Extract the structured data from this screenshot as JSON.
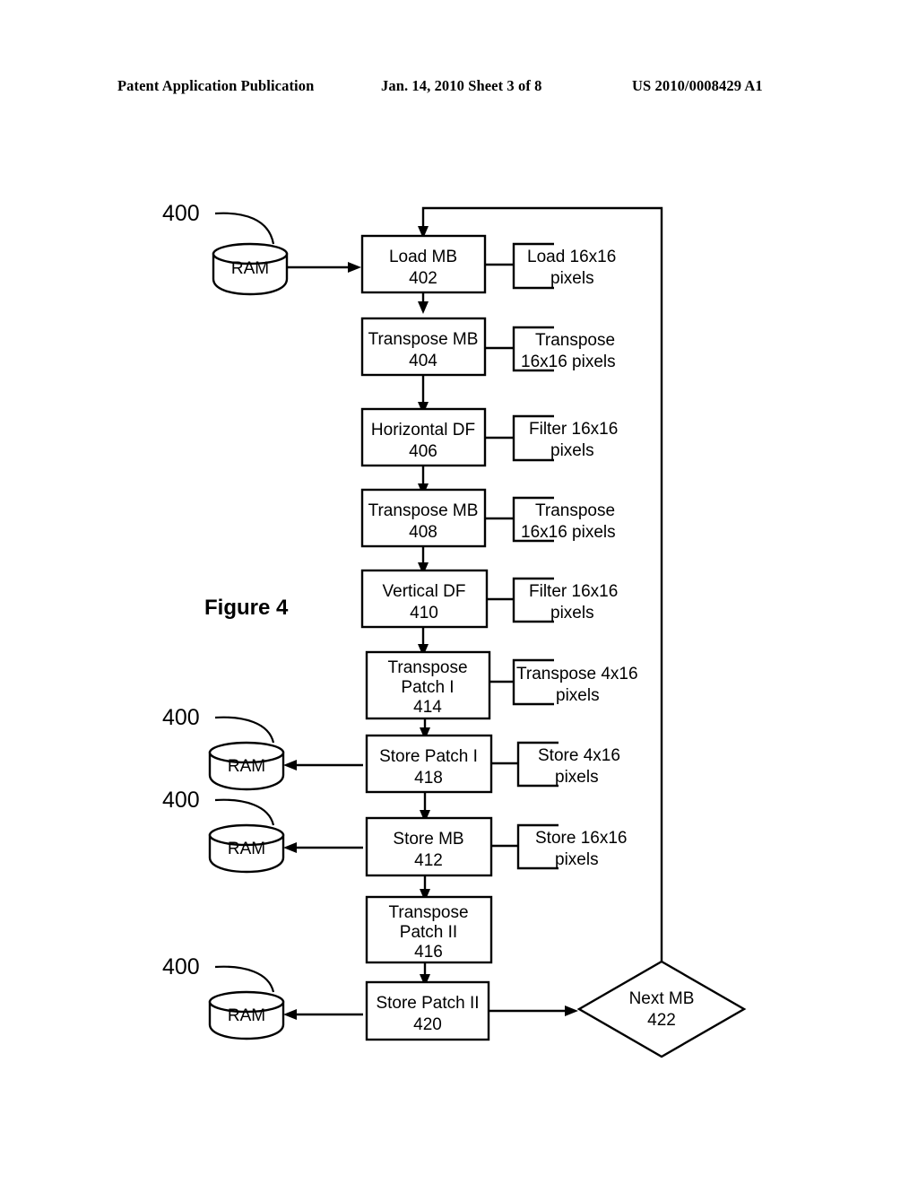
{
  "header": {
    "publication": "Patent Application Publication",
    "date_sheet": "Jan. 14, 2010  Sheet 3 of 8",
    "patent_number": "US 2010/0008429 A1"
  },
  "figure": {
    "caption": "Figure 4"
  },
  "colors": {
    "ink": "#000000",
    "paper": "#ffffff"
  },
  "ram_nodes": [
    {
      "ref": "400",
      "label": "RAM"
    },
    {
      "ref": "400",
      "label": "RAM"
    },
    {
      "ref": "400",
      "label": "RAM"
    },
    {
      "ref": "400",
      "label": "RAM"
    }
  ],
  "process_steps": [
    {
      "title": "Load MB",
      "ref": "402",
      "note": [
        "Load 16x16",
        "pixels"
      ]
    },
    {
      "title": "Transpose MB",
      "ref": "404",
      "note": [
        "Transpose",
        "16x16 pixels"
      ]
    },
    {
      "title": "Horizontal DF",
      "ref": "406",
      "note": [
        "Filter 16x16",
        "pixels"
      ]
    },
    {
      "title": "Transpose MB",
      "ref": "408",
      "note": [
        "Transpose",
        "16x16 pixels"
      ]
    },
    {
      "title": "Vertical DF",
      "ref": "410",
      "note": [
        "Filter 16x16",
        "pixels"
      ]
    },
    {
      "title": "Transpose",
      "title2": "Patch I",
      "ref": "414",
      "note": [
        "Transpose 4x16",
        "pixels"
      ]
    },
    {
      "title": "Store Patch I",
      "ref": "418",
      "note": [
        "Store 4x16",
        "pixels"
      ]
    },
    {
      "title": "Store MB",
      "ref": "412",
      "note": [
        "Store 16x16",
        "pixels"
      ]
    },
    {
      "title": "Transpose",
      "title2": "Patch II",
      "ref": "416",
      "note": []
    },
    {
      "title": "Store Patch II",
      "ref": "420",
      "note": []
    }
  ],
  "decision": {
    "title": "Next MB",
    "ref": "422"
  }
}
